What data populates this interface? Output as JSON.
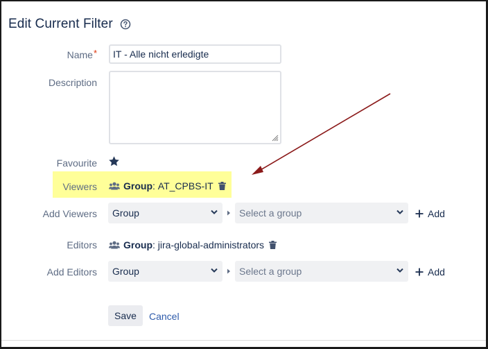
{
  "dialog": {
    "title": "Edit Current Filter",
    "help_icon": "help-circle-icon"
  },
  "fields": {
    "name_label": "Name",
    "name_required_marker": "*",
    "name_value": "IT - Alle nicht erledigte",
    "description_label": "Description",
    "description_value": "",
    "favourite_label": "Favourite",
    "favourite_icon": "star-icon",
    "favourite_starred": true
  },
  "viewers": {
    "label": "Viewers",
    "entries": [
      {
        "type_label": "Group",
        "separator": ":",
        "name": "AT_CPBS-IT"
      }
    ],
    "highlight_color": "#ffff99"
  },
  "add_viewers": {
    "label": "Add Viewers",
    "type_selected": "Group",
    "group_placeholder": "Select a group",
    "add_label": "Add"
  },
  "editors": {
    "label": "Editors",
    "entries": [
      {
        "type_label": "Group",
        "separator": ":",
        "name": "jira-global-administrators"
      }
    ]
  },
  "add_editors": {
    "label": "Add Editors",
    "type_selected": "Group",
    "group_placeholder": "Select a group",
    "add_label": "Add"
  },
  "actions": {
    "save_label": "Save",
    "cancel_label": "Cancel"
  },
  "colors": {
    "annotation_arrow": "#8b1a1a",
    "link": "#2e5bab",
    "required": "#de350b"
  }
}
